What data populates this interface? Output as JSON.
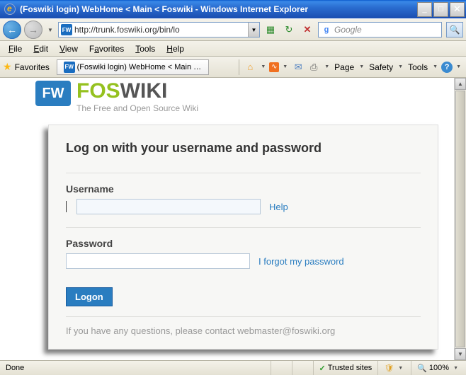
{
  "window": {
    "title": "(Foswiki login) WebHome < Main < Foswiki - Windows Internet Explorer"
  },
  "nav": {
    "url": "http://trunk.foswiki.org/bin/lo",
    "search_placeholder": "Google"
  },
  "menus": {
    "file": "File",
    "edit": "Edit",
    "view": "View",
    "favorites": "Favorites",
    "tools": "Tools",
    "help": "Help"
  },
  "cmdbar": {
    "favorites_label": "Favorites",
    "tab_title": "(Foswiki login) WebHome < Main < ...",
    "page": "Page",
    "safety": "Safety",
    "tools": "Tools"
  },
  "logo": {
    "badge": "FW",
    "part1": "FOS",
    "part2": "WIKI",
    "tagline": "The Free and Open Source Wiki"
  },
  "login": {
    "heading": "Log on with your username and password",
    "username_label": "Username",
    "username_help": "Help",
    "password_label": "Password",
    "password_help": "I forgot my password",
    "logon_button": "Logon",
    "footer": "If you have any questions, please contact webmaster@foswiki.org"
  },
  "status": {
    "done": "Done",
    "zone": "Trusted sites",
    "zoom": "100%"
  }
}
